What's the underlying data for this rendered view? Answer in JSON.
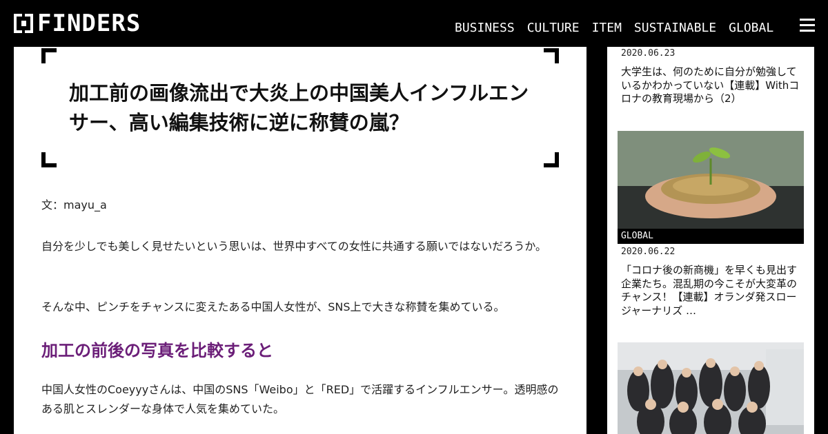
{
  "header": {
    "logo_text": "FINDERS",
    "nav": [
      "BUSINESS",
      "CULTURE",
      "ITEM",
      "SUSTAINABLE",
      "GLOBAL"
    ]
  },
  "article": {
    "title": "加工前の画像流出で大炎上の中国美人インフルエンサー、高い編集技術に逆に称賛の嵐？",
    "byline": "文：mayu_a",
    "paragraph1": "自分を少しでも美しく見せたいという思いは、世界中すべての女性に共通する願いではないだろうか。",
    "paragraph2": "そんな中、ピンチをチャンスに変えたある中国人女性が、SNS上で大きな称賛を集めている。",
    "heading": "加工の前後の写真を比較すると",
    "paragraph3": "中国人女性のCoeyyyさんは、中国のSNS「Weibo」と「RED」で活躍するインフルエンサー。透明感のある肌とスレンダーな身体で人気を集めていた。",
    "heading_color": "#6b1e78"
  },
  "sidebar": {
    "items": [
      {
        "date": "2020.06.23",
        "title": "大学生は、何のために自分が勉強しているかわかっていない【連載】Withコロナの教育現場から（2）"
      },
      {
        "category": "GLOBAL",
        "date": "2020.06.22",
        "title": "「コロナ後の新商機」を早くも見出す企業たち。混乱期の今こそが大変革のチャンス！【連載】オランダ発スロージャーナリズ …"
      }
    ]
  }
}
